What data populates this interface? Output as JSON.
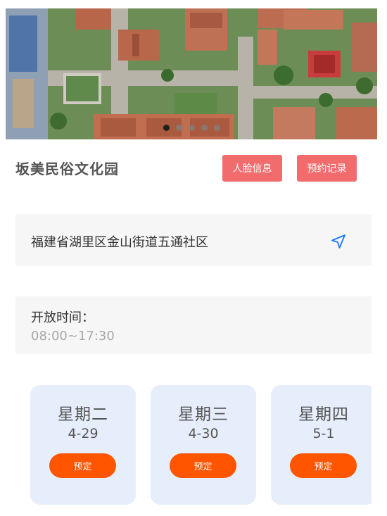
{
  "banner": {
    "image": "aerial-photo-of-folk-culture-park",
    "slide_count": 5,
    "active_slide": 1
  },
  "venue": {
    "title": "坂美民俗文化园",
    "face_info_label": "人脸信息",
    "booking_record_label": "预约记录"
  },
  "address": {
    "text": "福建省湖里区金山街道五通社区",
    "icon": "navigation-arrow-icon"
  },
  "hours": {
    "label": "开放时间：",
    "value": "08:00~17:30"
  },
  "days": [
    {
      "weekday": "星期二",
      "date": "4-29",
      "book_label": "预定"
    },
    {
      "weekday": "星期三",
      "date": "4-30",
      "book_label": "预定"
    },
    {
      "weekday": "星期四",
      "date": "5-1",
      "book_label": "预定"
    }
  ],
  "colors": {
    "accent_red": "#f26b6d",
    "book_orange": "#ff5500",
    "card_blue": "#e7eefb",
    "nav_blue": "#1677ff"
  }
}
